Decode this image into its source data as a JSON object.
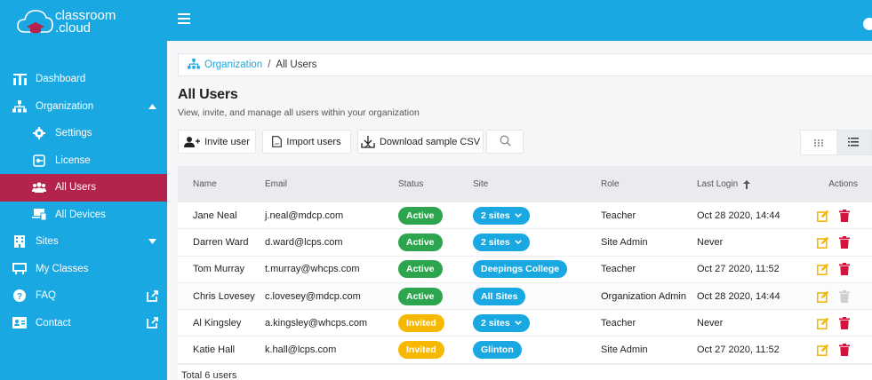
{
  "brand": {
    "line1": "classroom",
    "line2": ".cloud"
  },
  "sidebar": {
    "items": [
      {
        "label": "Dashboard",
        "icon": "dashboard-icon"
      },
      {
        "label": "Organization",
        "icon": "organization-icon"
      },
      {
        "label": "Settings",
        "icon": "gear-icon"
      },
      {
        "label": "License",
        "icon": "license-icon"
      },
      {
        "label": "All Users",
        "icon": "users-icon"
      },
      {
        "label": "All Devices",
        "icon": "devices-icon"
      },
      {
        "label": "Sites",
        "icon": "building-icon"
      },
      {
        "label": "My Classes",
        "icon": "classes-icon"
      },
      {
        "label": "FAQ",
        "icon": "help-icon"
      },
      {
        "label": "Contact",
        "icon": "contact-icon"
      }
    ]
  },
  "breadcrumb": {
    "parent": "Organization",
    "separator": "/",
    "current": "All Users"
  },
  "page": {
    "title": "All Users",
    "subtitle": "View, invite, and manage all users within your organization"
  },
  "toolbar": {
    "invite_label": "Invite user",
    "import_label": "Import users",
    "download_label": "Download sample CSV"
  },
  "table": {
    "headers": {
      "name": "Name",
      "email": "Email",
      "status": "Status",
      "site": "Site",
      "role": "Role",
      "last_login": "Last Login",
      "actions": "Actions"
    },
    "rows": [
      {
        "name": "Jane Neal",
        "email": "j.neal@mdcp.com",
        "status": "Active",
        "site": "2 sites",
        "role": "Teacher",
        "last_login": "Oct 28 2020, 14:44"
      },
      {
        "name": "Darren Ward",
        "email": "d.ward@lcps.com",
        "status": "Active",
        "site": "2 sites",
        "role": "Site Admin",
        "last_login": "Never"
      },
      {
        "name": "Tom Murray",
        "email": "t.murray@whcps.com",
        "status": "Active",
        "site": "Deepings College",
        "role": "Teacher",
        "last_login": "Oct 27 2020, 11:52"
      },
      {
        "name": "Chris Lovesey",
        "email": "c.lovesey@mdcp.com",
        "status": "Active",
        "site": "All Sites",
        "role": "Organization Admin",
        "last_login": "Oct 28 2020, 14:44"
      },
      {
        "name": "Al Kingsley",
        "email": "a.kingsley@whcps.com",
        "status": "Invited",
        "site": "2 sites",
        "role": "Teacher",
        "last_login": "Never"
      },
      {
        "name": "Katie Hall",
        "email": "k.hall@lcps.com",
        "status": "Invited",
        "site": "Glinton",
        "role": "Site Admin",
        "last_login": "Oct 27 2020, 11:52"
      }
    ],
    "total": "Total 6 users"
  },
  "colors": {
    "brand": "#1aa8e3",
    "active_nav": "#b3234b",
    "active_status": "#2da44e",
    "invited_status": "#f6b800",
    "edit": "#f2b705",
    "delete": "#d3123e"
  }
}
